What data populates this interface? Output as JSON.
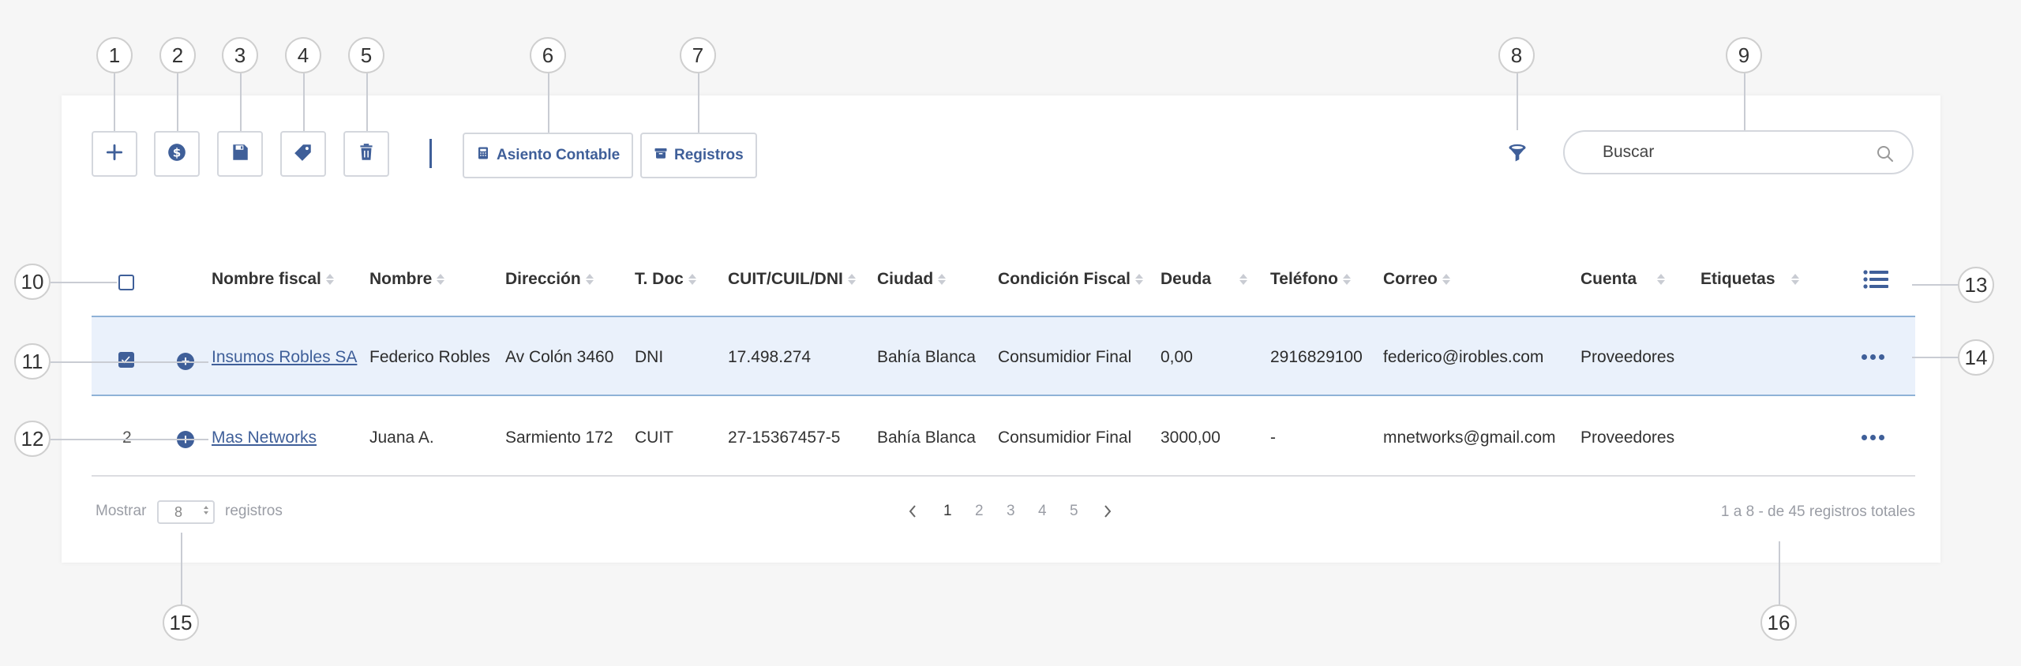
{
  "callouts": [
    "1",
    "2",
    "3",
    "4",
    "5",
    "6",
    "7",
    "8",
    "9",
    "10",
    "11",
    "12",
    "13",
    "14",
    "15",
    "16"
  ],
  "toolbar": {
    "add_icon": "plus-icon",
    "payment_icon": "dollar-circle-icon",
    "save_icon": "floppy-disk-icon",
    "tag_icon": "tag-icon",
    "delete_icon": "trash-icon",
    "asiento_label": "Asiento Contable",
    "registros_label": "Registros",
    "filter_icon": "filter-icon"
  },
  "search": {
    "placeholder": "Buscar"
  },
  "columns": [
    "Nombre fiscal",
    "Nombre",
    "Dirección",
    "T. Doc",
    "CUIT/CUIL/DNI",
    "Ciudad",
    "Condición Fiscal",
    "Deuda",
    "Teléfono",
    "Correo",
    "Cuenta",
    "Etiquetas"
  ],
  "rows": [
    {
      "index": "",
      "checked": true,
      "nombre_fiscal": "Insumos Robles SA",
      "nombre": "Federico Robles",
      "direccion": "Av Colón 3460",
      "tdoc": "DNI",
      "cuit": "17.498.274",
      "ciudad": "Bahía Blanca",
      "condicion": "Consumidior Final",
      "deuda": "0,00",
      "telefono": "2916829100",
      "correo": "federico@irobles.com",
      "cuenta": "Proveedores",
      "etiquetas": ""
    },
    {
      "index": "2",
      "checked": false,
      "nombre_fiscal": "Mas Networks",
      "nombre": "Juana A.",
      "direccion": "Sarmiento 172",
      "tdoc": "CUIT",
      "cuit": "27-15367457-5",
      "ciudad": "Bahía Blanca",
      "condicion": "Consumidior Final",
      "deuda": "3000,00",
      "telefono": "-",
      "correo": "mnetworks@gmail.com",
      "cuenta": "Proveedores",
      "etiquetas": ""
    }
  ],
  "footer": {
    "show_label": "Mostrar",
    "show_value": "8",
    "records_label": "registros",
    "pages": [
      "1",
      "2",
      "3",
      "4",
      "5"
    ],
    "active_page": "1",
    "total_text": "1 a 8 - de 45 registros totales"
  },
  "colors": {
    "accent": "#3f5f99",
    "row_selected": "#eaf1fb",
    "border": "#d4d7dd"
  }
}
